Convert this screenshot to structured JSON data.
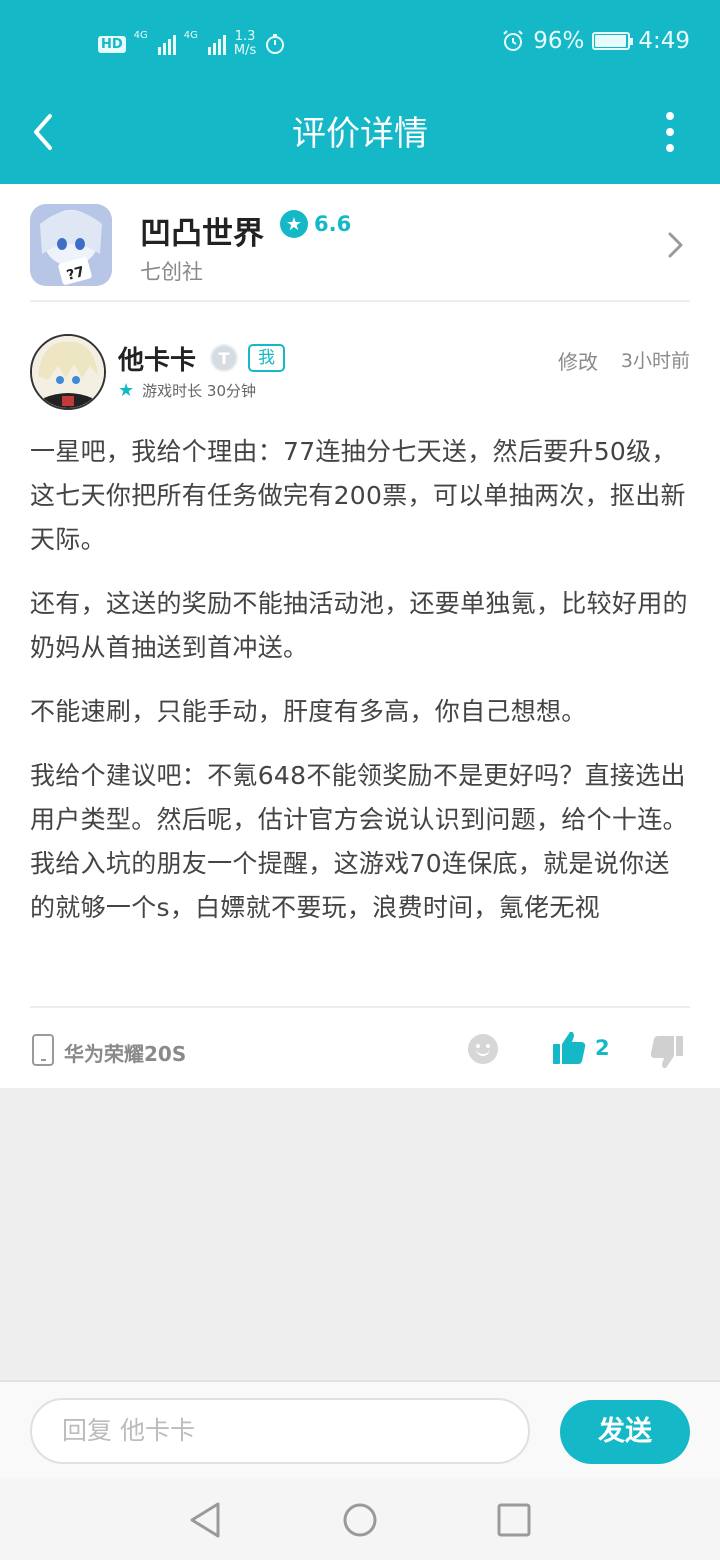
{
  "status_bar": {
    "hd": "HD",
    "lte1": "4G",
    "lte2": "4G",
    "net_speed_value": "1.3",
    "net_speed_unit": "M/s",
    "battery_percent": "96%",
    "time": "4:49"
  },
  "app_bar": {
    "title": "评价详情"
  },
  "game": {
    "name": "凹凸世界",
    "score": "6.6",
    "developer": "七创社"
  },
  "review": {
    "user_name": "他卡卡",
    "level_badge": "T",
    "me_tag": "我",
    "play_time": "游戏时长 30分钟",
    "edit_label": "修改",
    "time_ago": "3小时前",
    "paragraphs": [
      "一星吧，我给个理由：77连抽分七天送，然后要升50级，这七天你把所有任务做完有200票，可以单抽两次，抠出新天际。",
      "还有，这送的奖励不能抽活动池，还要单独氪，比较好用的奶妈从首抽送到首冲送。",
      "不能速刷，只能手动，肝度有多高，你自己想想。",
      "我给个建议吧：不氪648不能领奖励不是更好吗？直接选出用户类型。然后呢，估计官方会说认识到问题，给个十连。我给入坑的朋友一个提醒，这游戏70连保底，就是说你送的就够一个s，白嫖就不要玩，浪费时间，氪佬无视"
    ],
    "device": "华为荣耀20S",
    "like_count": "2"
  },
  "reply": {
    "placeholder": "回复 他卡卡",
    "send_label": "发送"
  },
  "colors": {
    "accent": "#15b8c7",
    "text_primary": "#222222",
    "text_secondary": "#8a8a8a"
  },
  "icons": [
    "back-arrow-icon",
    "more-vert-icon",
    "star-icon",
    "chevron-right-icon",
    "phone-icon",
    "emoji-icon",
    "thumbs-up-icon",
    "thumbs-down-icon",
    "nav-back-icon",
    "nav-home-icon",
    "nav-recent-icon"
  ]
}
